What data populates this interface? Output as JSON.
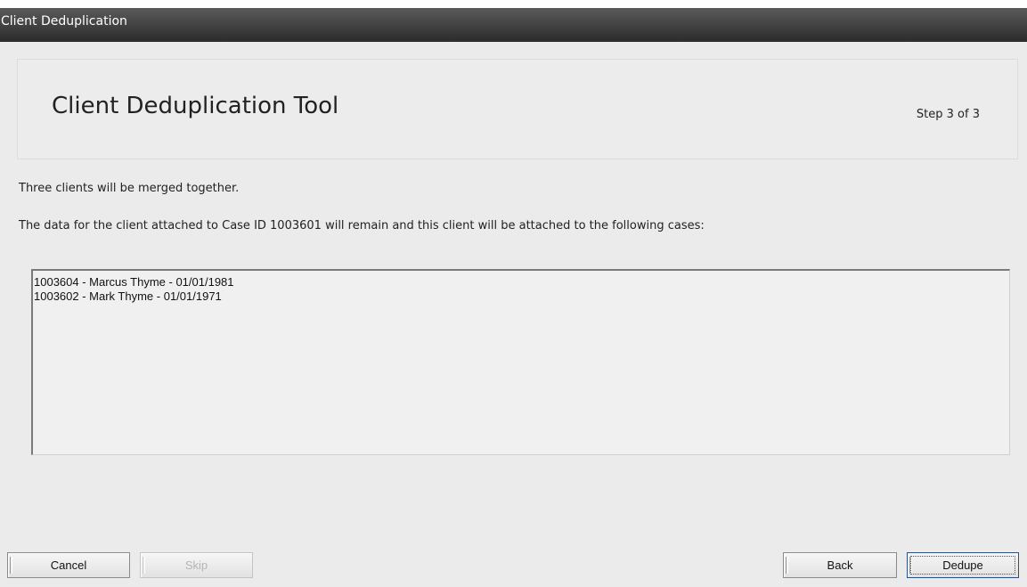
{
  "window": {
    "title": "Client Deduplication"
  },
  "header": {
    "title": "Client Deduplication Tool",
    "step": "Step 3 of 3"
  },
  "messages": {
    "summary": "Three clients will be merged together.",
    "detail": "The data for the client attached to Case ID 1003601 will remain and this client will be attached to the following cases:"
  },
  "cases": [
    "1003604 - Marcus Thyme - 01/01/1981",
    "1003602 - Mark Thyme - 01/01/1971"
  ],
  "buttons": {
    "cancel": "Cancel",
    "skip": "Skip",
    "back": "Back",
    "dedupe": "Dedupe"
  }
}
